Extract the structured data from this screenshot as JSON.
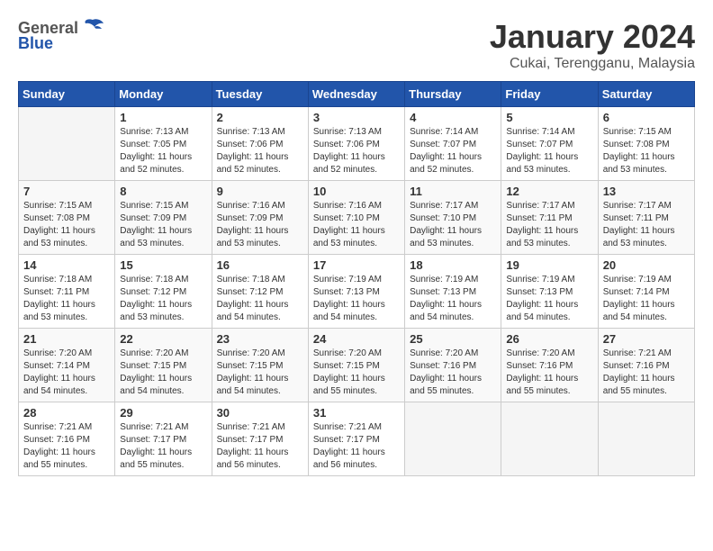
{
  "header": {
    "logo_general": "General",
    "logo_blue": "Blue",
    "month_title": "January 2024",
    "location": "Cukai, Terengganu, Malaysia"
  },
  "days_of_week": [
    "Sunday",
    "Monday",
    "Tuesday",
    "Wednesday",
    "Thursday",
    "Friday",
    "Saturday"
  ],
  "weeks": [
    [
      {
        "day": "",
        "info": ""
      },
      {
        "day": "1",
        "info": "Sunrise: 7:13 AM\nSunset: 7:05 PM\nDaylight: 11 hours\nand 52 minutes."
      },
      {
        "day": "2",
        "info": "Sunrise: 7:13 AM\nSunset: 7:06 PM\nDaylight: 11 hours\nand 52 minutes."
      },
      {
        "day": "3",
        "info": "Sunrise: 7:13 AM\nSunset: 7:06 PM\nDaylight: 11 hours\nand 52 minutes."
      },
      {
        "day": "4",
        "info": "Sunrise: 7:14 AM\nSunset: 7:07 PM\nDaylight: 11 hours\nand 52 minutes."
      },
      {
        "day": "5",
        "info": "Sunrise: 7:14 AM\nSunset: 7:07 PM\nDaylight: 11 hours\nand 53 minutes."
      },
      {
        "day": "6",
        "info": "Sunrise: 7:15 AM\nSunset: 7:08 PM\nDaylight: 11 hours\nand 53 minutes."
      }
    ],
    [
      {
        "day": "7",
        "info": "Sunrise: 7:15 AM\nSunset: 7:08 PM\nDaylight: 11 hours\nand 53 minutes."
      },
      {
        "day": "8",
        "info": "Sunrise: 7:15 AM\nSunset: 7:09 PM\nDaylight: 11 hours\nand 53 minutes."
      },
      {
        "day": "9",
        "info": "Sunrise: 7:16 AM\nSunset: 7:09 PM\nDaylight: 11 hours\nand 53 minutes."
      },
      {
        "day": "10",
        "info": "Sunrise: 7:16 AM\nSunset: 7:10 PM\nDaylight: 11 hours\nand 53 minutes."
      },
      {
        "day": "11",
        "info": "Sunrise: 7:17 AM\nSunset: 7:10 PM\nDaylight: 11 hours\nand 53 minutes."
      },
      {
        "day": "12",
        "info": "Sunrise: 7:17 AM\nSunset: 7:11 PM\nDaylight: 11 hours\nand 53 minutes."
      },
      {
        "day": "13",
        "info": "Sunrise: 7:17 AM\nSunset: 7:11 PM\nDaylight: 11 hours\nand 53 minutes."
      }
    ],
    [
      {
        "day": "14",
        "info": "Sunrise: 7:18 AM\nSunset: 7:11 PM\nDaylight: 11 hours\nand 53 minutes."
      },
      {
        "day": "15",
        "info": "Sunrise: 7:18 AM\nSunset: 7:12 PM\nDaylight: 11 hours\nand 53 minutes."
      },
      {
        "day": "16",
        "info": "Sunrise: 7:18 AM\nSunset: 7:12 PM\nDaylight: 11 hours\nand 54 minutes."
      },
      {
        "day": "17",
        "info": "Sunrise: 7:19 AM\nSunset: 7:13 PM\nDaylight: 11 hours\nand 54 minutes."
      },
      {
        "day": "18",
        "info": "Sunrise: 7:19 AM\nSunset: 7:13 PM\nDaylight: 11 hours\nand 54 minutes."
      },
      {
        "day": "19",
        "info": "Sunrise: 7:19 AM\nSunset: 7:13 PM\nDaylight: 11 hours\nand 54 minutes."
      },
      {
        "day": "20",
        "info": "Sunrise: 7:19 AM\nSunset: 7:14 PM\nDaylight: 11 hours\nand 54 minutes."
      }
    ],
    [
      {
        "day": "21",
        "info": "Sunrise: 7:20 AM\nSunset: 7:14 PM\nDaylight: 11 hours\nand 54 minutes."
      },
      {
        "day": "22",
        "info": "Sunrise: 7:20 AM\nSunset: 7:15 PM\nDaylight: 11 hours\nand 54 minutes."
      },
      {
        "day": "23",
        "info": "Sunrise: 7:20 AM\nSunset: 7:15 PM\nDaylight: 11 hours\nand 54 minutes."
      },
      {
        "day": "24",
        "info": "Sunrise: 7:20 AM\nSunset: 7:15 PM\nDaylight: 11 hours\nand 55 minutes."
      },
      {
        "day": "25",
        "info": "Sunrise: 7:20 AM\nSunset: 7:16 PM\nDaylight: 11 hours\nand 55 minutes."
      },
      {
        "day": "26",
        "info": "Sunrise: 7:20 AM\nSunset: 7:16 PM\nDaylight: 11 hours\nand 55 minutes."
      },
      {
        "day": "27",
        "info": "Sunrise: 7:21 AM\nSunset: 7:16 PM\nDaylight: 11 hours\nand 55 minutes."
      }
    ],
    [
      {
        "day": "28",
        "info": "Sunrise: 7:21 AM\nSunset: 7:16 PM\nDaylight: 11 hours\nand 55 minutes."
      },
      {
        "day": "29",
        "info": "Sunrise: 7:21 AM\nSunset: 7:17 PM\nDaylight: 11 hours\nand 55 minutes."
      },
      {
        "day": "30",
        "info": "Sunrise: 7:21 AM\nSunset: 7:17 PM\nDaylight: 11 hours\nand 56 minutes."
      },
      {
        "day": "31",
        "info": "Sunrise: 7:21 AM\nSunset: 7:17 PM\nDaylight: 11 hours\nand 56 minutes."
      },
      {
        "day": "",
        "info": ""
      },
      {
        "day": "",
        "info": ""
      },
      {
        "day": "",
        "info": ""
      }
    ]
  ]
}
